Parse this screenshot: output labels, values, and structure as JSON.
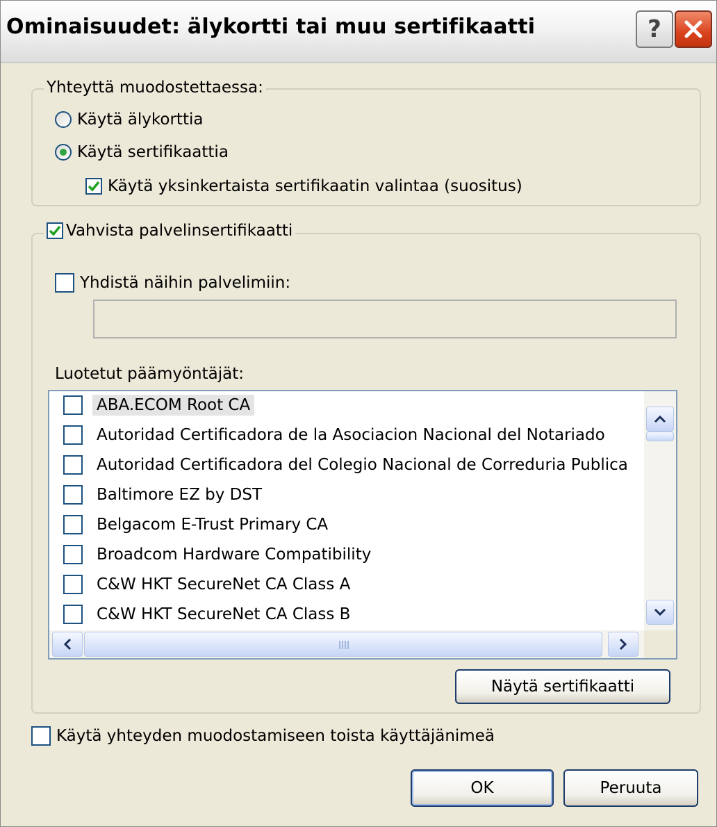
{
  "window": {
    "title": "Ominaisuudet: älykortti tai muu sertifikaatti",
    "help_glyph": "?",
    "close_icon": "close-icon"
  },
  "connect_group": {
    "legend": "Yhteyttä muodostettaessa:",
    "options": [
      {
        "label": "Käytä älykorttia",
        "selected": false
      },
      {
        "label": "Käytä sertifikaattia",
        "selected": true
      }
    ],
    "simple_selection": {
      "label": "Käytä yksinkertaista sertifikaatin valintaa (suositus)",
      "checked": true
    }
  },
  "validate_group": {
    "legend": "Vahvista palvelinsertifikaatti",
    "legend_checked": true,
    "connect_servers": {
      "label": "Yhdistä näihin palvelimiin:",
      "checked": false,
      "value": ""
    },
    "trusted_label": "Luotetut päämyöntäjät:",
    "trusted_roots": [
      {
        "label": "ABA.ECOM Root CA",
        "checked": false,
        "selected": true
      },
      {
        "label": "Autoridad Certificadora de la Asociacion Nacional del Notariado",
        "checked": false
      },
      {
        "label": "Autoridad Certificadora del Colegio Nacional de Correduria Publica",
        "checked": false
      },
      {
        "label": "Baltimore EZ by DST",
        "checked": false
      },
      {
        "label": "Belgacom E-Trust Primary CA",
        "checked": false
      },
      {
        "label": "Broadcom Hardware Compatibility",
        "checked": false
      },
      {
        "label": "C&W HKT SecureNet CA Class A",
        "checked": false
      },
      {
        "label": "C&W HKT SecureNet CA Class B",
        "checked": false
      }
    ],
    "view_cert_button": "Näytä sertifikaatti"
  },
  "other_username": {
    "label": "Käytä yhteyden muodostamiseen toista käyttäjänimeä",
    "checked": false
  },
  "buttons": {
    "ok": "OK",
    "cancel": "Peruuta"
  },
  "colors": {
    "accent": "#1c5180",
    "radio_dot": "#31a541",
    "close_red": "#d9431d"
  }
}
